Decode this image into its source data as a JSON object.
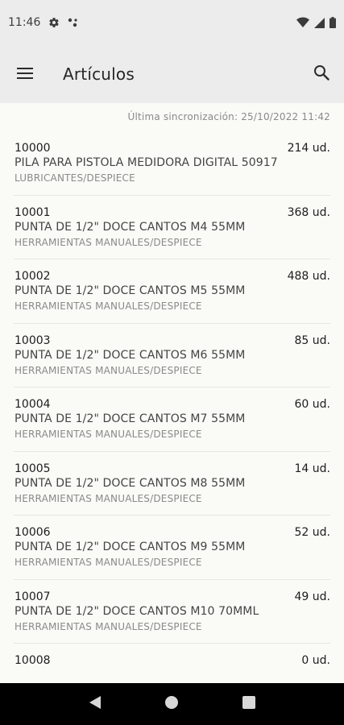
{
  "status_bar": {
    "time": "11:46",
    "icons": [
      "settings-icon",
      "signal-dots-icon",
      "wifi-icon",
      "cell-signal-icon",
      "battery-icon"
    ]
  },
  "app_bar": {
    "title": "Artículos",
    "menu_icon": "hamburger-menu-icon",
    "search_icon": "search-icon"
  },
  "sync_text": "Última sincronización: 25/10/2022 11:42",
  "items": [
    {
      "code": "10000",
      "qty": "214 ud.",
      "description": "PILA PARA PISTOLA MEDIDORA DIGITAL 50917",
      "category": "LUBRICANTES/DESPIECE"
    },
    {
      "code": "10001",
      "qty": "368 ud.",
      "description": "PUNTA DE 1/2\"  DOCE CANTOS M4 55MM",
      "category": "HERRAMIENTAS MANUALES/DESPIECE"
    },
    {
      "code": "10002",
      "qty": "488 ud.",
      "description": "PUNTA DE 1/2\"  DOCE CANTOS M5 55MM",
      "category": "HERRAMIENTAS MANUALES/DESPIECE"
    },
    {
      "code": "10003",
      "qty": "85 ud.",
      "description": "PUNTA DE 1/2\"  DOCE CANTOS M6 55MM",
      "category": "HERRAMIENTAS MANUALES/DESPIECE"
    },
    {
      "code": "10004",
      "qty": "60 ud.",
      "description": "PUNTA DE 1/2\"  DOCE CANTOS M7 55MM",
      "category": "HERRAMIENTAS MANUALES/DESPIECE"
    },
    {
      "code": "10005",
      "qty": "14 ud.",
      "description": "PUNTA DE 1/2\"  DOCE CANTOS M8 55MM",
      "category": "HERRAMIENTAS MANUALES/DESPIECE"
    },
    {
      "code": "10006",
      "qty": "52 ud.",
      "description": "PUNTA DE 1/2\"  DOCE CANTOS M9 55MM",
      "category": "HERRAMIENTAS MANUALES/DESPIECE"
    },
    {
      "code": "10007",
      "qty": "49 ud.",
      "description": "PUNTA DE 1/2\"  DOCE CANTOS M10 70MML",
      "category": "HERRAMIENTAS MANUALES/DESPIECE"
    },
    {
      "code": "10008",
      "qty": "0 ud.",
      "description": "",
      "category": ""
    }
  ],
  "nav_bar": {
    "icons": [
      "back-triangle-icon",
      "home-circle-icon",
      "recents-square-icon"
    ]
  }
}
